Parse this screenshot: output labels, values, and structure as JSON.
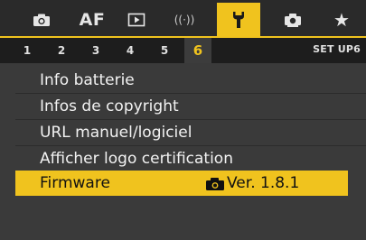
{
  "top_tabs": [
    {
      "icon": "camera-icon"
    },
    {
      "label": "AF"
    },
    {
      "icon": "playback-icon"
    },
    {
      "label": "((·))",
      "icon": "wireless-icon"
    },
    {
      "icon": "wrench-icon",
      "active": true
    },
    {
      "icon": "custom-functions-icon"
    },
    {
      "icon": "star-icon",
      "label": "★"
    }
  ],
  "sub_tabs": [
    "1",
    "2",
    "3",
    "4",
    "5",
    "6"
  ],
  "sub_tab_active": "6",
  "set_label": "SET UP6",
  "menu": {
    "items": [
      {
        "label": "Info batterie"
      },
      {
        "label": "Infos de copyright"
      },
      {
        "label": "URL manuel/logiciel"
      },
      {
        "label": "Afficher logo certification"
      },
      {
        "label": "Firmware",
        "value": "Ver. 1.8.1",
        "value_icon": "camera-icon",
        "selected": true
      }
    ]
  },
  "colors": {
    "accent": "#f0c31e",
    "background": "#3a3a3a",
    "tabbar": "#2a2a2a"
  }
}
